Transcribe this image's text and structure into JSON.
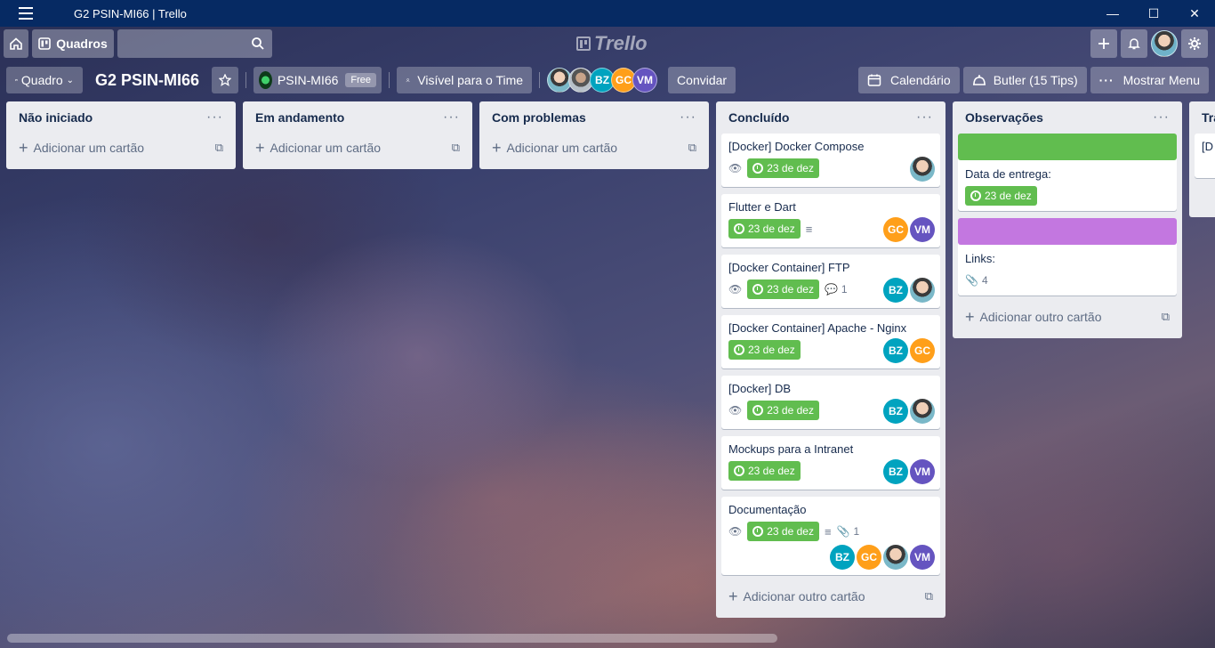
{
  "window": {
    "title": "G2 PSIN-MI66 | Trello",
    "minimize": "—",
    "maximize": "☐",
    "close": "✕"
  },
  "header": {
    "boards_label": "Quadros",
    "logo_text": "Trello"
  },
  "board": {
    "view_label": "Quadro",
    "title": "G2 PSIN-MI66",
    "team_name": "PSIN-MI66",
    "team_badge": "Free",
    "visibility_label": "Visível para o Time",
    "members": [
      "BZ",
      "GC",
      "VM"
    ],
    "invite_label": "Convidar",
    "calendar_label": "Calendário",
    "butler_label": "Butler (15 Tips)",
    "menu_label": "Mostrar Menu"
  },
  "lists": [
    {
      "title": "Não iniciado",
      "add_label": "Adicionar um cartão"
    },
    {
      "title": "Em andamento",
      "add_label": "Adicionar um cartão"
    },
    {
      "title": "Com problemas",
      "add_label": "Adicionar um cartão"
    },
    {
      "title": "Concluído",
      "add_label": "Adicionar outro cartão",
      "cards": [
        {
          "title": "[Docker] Docker Compose",
          "due": "23 de dez"
        },
        {
          "title": "Flutter e Dart",
          "due": "23 de dez",
          "members": [
            "GC",
            "VM"
          ]
        },
        {
          "title": "[Docker Container] FTP",
          "due": "23 de dez",
          "comments": "1",
          "members": [
            "BZ"
          ]
        },
        {
          "title": "[Docker Container] Apache - Nginx",
          "due": "23 de dez",
          "members": [
            "BZ",
            "GC"
          ]
        },
        {
          "title": "[Docker] DB",
          "due": "23 de dez",
          "members": [
            "BZ"
          ]
        },
        {
          "title": "Mockups para a Intranet",
          "due": "23 de dez",
          "members": [
            "BZ",
            "VM"
          ]
        },
        {
          "title": "Documentação",
          "due": "23 de dez",
          "attachments": "1",
          "members": [
            "BZ",
            "GC",
            "VM"
          ]
        }
      ]
    },
    {
      "title": "Observações",
      "add_label": "Adicionar outro cartão",
      "cards": [
        {
          "label_color": "#61bd4f",
          "title": "Data de entrega:",
          "due": "23 de dez"
        },
        {
          "label_color": "#c377e0",
          "title": "Links:",
          "attachments": "4"
        }
      ]
    },
    {
      "title": "Tra",
      "card_title": "[D"
    }
  ]
}
